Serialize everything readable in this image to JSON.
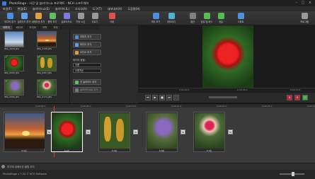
{
  "window": {
    "title": "PhotoStage - 사진 및 슬라이드쇼 프로젝트 - NCH 소프트웨어"
  },
  "menu": [
    "파일(F)",
    "편집(E)",
    "슬라이드쇼(S)",
    "슬라이드(L)",
    "오디오(A)",
    "도구(T)",
    "내보내기(X)",
    "도움말(H)"
  ],
  "toolbar": [
    {
      "label": "미디어 추가",
      "color": "#4a8fe0"
    },
    {
      "label": "슬라이드 추가",
      "color": "#5fa0e8"
    },
    {
      "label": "내레이션 추가",
      "color": "#e0a040"
    },
    {
      "label": "음악 추가",
      "color": "#5fbf5f"
    },
    {
      "label": "슬라이드쇼",
      "color": "#7a7ae0"
    },
    {
      "label": "지속 시간",
      "color": "#999999"
    },
    {
      "label": "자르기",
      "color": "#999999"
    },
    {
      "label": "삭제",
      "color": "#e05050"
    },
    {
      "label": "미리 보기",
      "color": "#4a8fe0"
    },
    {
      "label": "내보내기",
      "color": "#50b0d0"
    },
    {
      "label": "옵션",
      "color": "#808080"
    },
    {
      "label": "공유 및 버스",
      "color": "#50c050"
    },
    {
      "label": "공유",
      "color": "#50c050"
    },
    {
      "label": "스위트",
      "color": "#5090e0"
    },
    {
      "label": "프로그램",
      "color": "#9a9a9a"
    }
  ],
  "media_tabs": [
    "이미지",
    "비디오",
    "오디오",
    "자막",
    "모두"
  ],
  "media_files": [
    {
      "name": "IMG_2033.JPG",
      "checked": false,
      "kind": "sky"
    },
    {
      "name": "IMG_2135.JPG",
      "checked": false,
      "kind": "sunset"
    },
    {
      "name": "IMG_0950.JPG",
      "checked": true,
      "kind": "redflower"
    },
    {
      "name": "IMG_0957.JPG",
      "checked": true,
      "kind": "corn"
    },
    {
      "name": "IMG_0956.JPG",
      "checked": true,
      "kind": "purpleflower"
    },
    {
      "name": "IMG_4174.JPG",
      "checked": true,
      "kind": "hand"
    }
  ],
  "actions": {
    "add_image": "이미지 추가",
    "add_video": "비디오 추가",
    "add_audio": "오디오 추가",
    "order_label": "미디어 정렬:",
    "sort_by": "이름",
    "sort_dir": "오름차순",
    "add_to_slideshow": "선 슬라이드 추가",
    "add_all": "슬라이드쇼로 추가"
  },
  "preview": {
    "time_left": "0:00:00.0",
    "time_mid": "0:00:05.0",
    "time_right": "0:00:10.0"
  },
  "timeline": {
    "marks": [
      "0:00:00.0",
      "0:00:05.0",
      "0:00:10.0",
      "0:00:15.0",
      "0:00:20.0",
      "0:00:25.0",
      "0:00:30.0"
    ],
    "clips": [
      {
        "label": "5.0초",
        "kind": "sunset"
      },
      {
        "label": "5.0초",
        "kind": "redflower"
      },
      {
        "label": "5.0초",
        "kind": "corn"
      },
      {
        "label": "5.0초",
        "kind": "purpleflower"
      },
      {
        "label": "5.0초",
        "kind": "hand"
      }
    ],
    "narration_hint": "여기에 내레이션 클립 추가"
  },
  "status": {
    "text": "PhotoStage v 7.54 © NCH Software"
  }
}
